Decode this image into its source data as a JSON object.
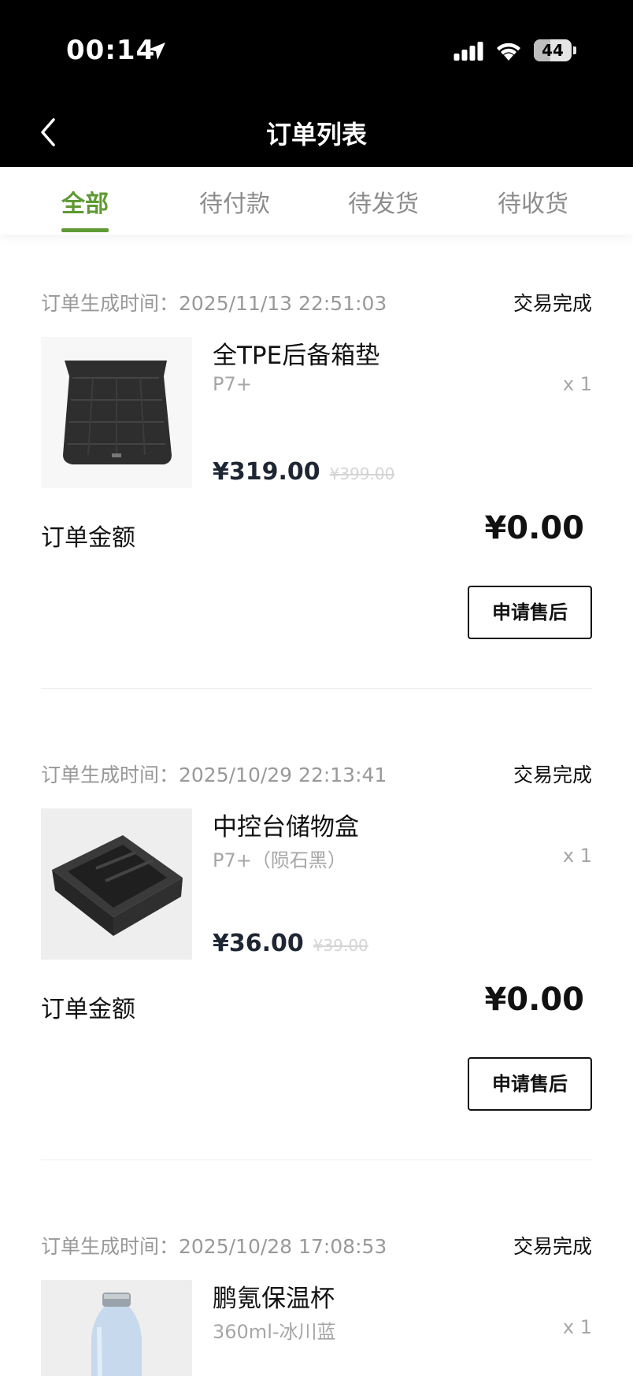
{
  "status_bar": {
    "time": "00:14",
    "battery_level": "44",
    "battery_fraction": 0.44
  },
  "nav": {
    "title": "订单列表"
  },
  "tabs": [
    {
      "label": "全部",
      "active": true
    },
    {
      "label": "待付款",
      "active": false
    },
    {
      "label": "待发货",
      "active": false
    },
    {
      "label": "待收货",
      "active": false
    }
  ],
  "colors": {
    "accent": "#5f9a34",
    "header_bg": "#000000"
  },
  "orders": [
    {
      "time_label": "订单生成时间：2025/11/13 22:51:03",
      "status": "交易完成",
      "product": {
        "name": "全TPE后备箱垫",
        "variant": "P7+",
        "qty": "x 1",
        "price": "¥319.00",
        "original_price": "¥399.00",
        "image": "trunk-mat"
      },
      "amount_label": "订单金额",
      "amount": "¥0.00",
      "action": "申请售后"
    },
    {
      "time_label": "订单生成时间：2025/10/29 22:13:41",
      "status": "交易完成",
      "product": {
        "name": "中控台储物盒",
        "variant": "P7+（陨石黑）",
        "qty": "x 1",
        "price": "¥36.00",
        "original_price": "¥39.00",
        "image": "console-storage-box"
      },
      "amount_label": "订单金额",
      "amount": "¥0.00",
      "action": "申请售后"
    },
    {
      "time_label": "订单生成时间：2025/10/28 17:08:53",
      "status": "交易完成",
      "product": {
        "name": "鹏氪保温杯",
        "variant": "360ml-冰川蓝",
        "qty": "x 1",
        "image": "insulated-bottle"
      }
    }
  ]
}
